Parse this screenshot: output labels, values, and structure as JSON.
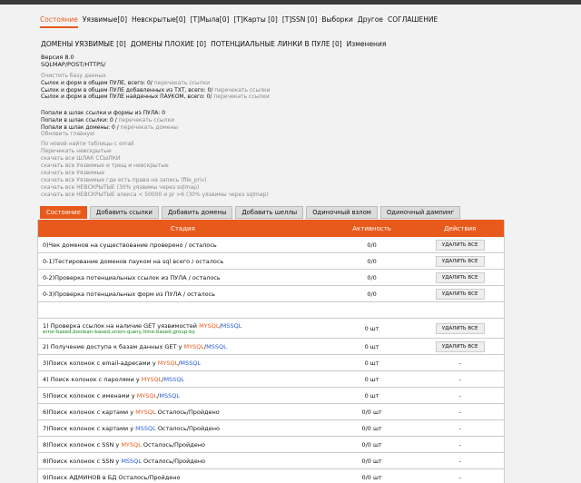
{
  "nav": {
    "items": [
      "Состояние",
      "Уязвимые[0]",
      "Невскрытые[0]",
      "[T]Мыла[0]",
      "[T]Карты [0]",
      "[T]SSN [0]",
      "Выборки",
      "Другое",
      "СОГЛАШЕНИЕ"
    ]
  },
  "subnav": {
    "items": [
      "ДОМЕНЫ УЯЗВИМЫЕ [0]",
      "ДОМЕНЫ ПЛОХИЕ [0]",
      "ПОТЕНЦИАЛЬНЫЕ ЛИНКИ В ПУЛЕ [0]",
      "Изменения"
    ]
  },
  "version": {
    "line1": "Версия 8.0",
    "line2": "SQLMAP/POST/HTTPS/"
  },
  "info": {
    "clear": "Очистить базу данных",
    "l1_text": "Сылок и форм в общем ПУЛЕ, всего: 0/",
    "l1_link": "перечекать ссылки",
    "l2_text": "Сылок и форм в общем ПУЛЕ добавленных из TXT, всего: 0/",
    "l2_link": "перечекать ссылки",
    "l3_text": "Сылок и форм в общем ПУЛЕ найденных ПАУКОМ, всего: 0/",
    "l3_link": "перечекать ссылки"
  },
  "info2": {
    "l1": "Попали в шлак ссылки и формы из ПУЛА: 0",
    "l2_text": "Попали в шлак ссылки: 0 /",
    "l2_link": "перечекать ссылки",
    "l3_text": "Попали в шлак домены: 0 /",
    "l3_link": "перечекать домены",
    "l4": "Обновить главную"
  },
  "info3": {
    "lines": [
      "По новой найти таблицы с email",
      "Перечекать невскрытые",
      "скачать все ШЛАК ССЫЛКИ",
      "скачать все Уязвимые и трещ и невскрытые",
      "скачать все Уязвимые",
      "скачать все Уязвимые где есть права на запись (file_priv)",
      "скачать все НЕВСКРЫТЫЕ (30% уязвимы через sqlmap)",
      "скачать все НЕВСКРЫТЫЕ алекса < 50000 и pr >6 (30% уязвимы через sqlmap)"
    ]
  },
  "tabs": [
    "Состояние",
    "Добавить ссылки",
    "Добавить домены",
    "Добавить шеллы",
    "Одиночный взлом",
    "Одиночный дампинг"
  ],
  "table": {
    "headers": [
      "Стадия",
      "Активность",
      "Действия"
    ],
    "delete_label": "УДАЛИТЬ ВСЕ",
    "dash": "-",
    "rows1": [
      {
        "stage": "0)Чек доменов на существование проверено / осталось",
        "activity": "0/0"
      },
      {
        "stage": "0-1)Тестирование доменов пауком на sql всего / осталось",
        "activity": "0/0"
      },
      {
        "stage": "0-2)Проверка потенциальных ссылок из ПУЛА / осталось",
        "activity": "0/0"
      },
      {
        "stage": "0-3)Проверка потенциальных форм из ПУЛА / осталось",
        "activity": "0/0"
      }
    ],
    "r1": {
      "a": "1) Проверка ссылок на наличие GET уязвимостей ",
      "mysql": "MYSQL",
      "sep": "/",
      "mssql": "MSSQL",
      "sub": "error-based,boolean-based,union-query,time-based,group-by",
      "activity": "0 шт"
    },
    "r2": {
      "a": "2) Получение доступа к базам данных GET у ",
      "mysql": "MYSQL",
      "sep": "/",
      "mssql": "MSSQL",
      "activity": "0 шт"
    },
    "r3": {
      "a": "3)Поиск колонок с email-адресами у ",
      "mysql": "MYSQL",
      "sep": "/",
      "mssql": "MSSQL",
      "activity": "0 шт"
    },
    "r4": {
      "a": "4) Поиск колонок с паролями у ",
      "mysql": "MYSQL",
      "sep": "/",
      "mssql": "MSSQL",
      "activity": "0 шт"
    },
    "r5": {
      "a": "5)Поиск колонок с именами у ",
      "mysql": "MYSQL",
      "sep": "/",
      "mssql": "MSSQL",
      "activity": "0 шт"
    },
    "r6": {
      "a": "6)Поиск колонок с картами у ",
      "mysql": "MYSQL",
      "b": " Осталось/Пройдено",
      "activity": "0/0 шт"
    },
    "r7": {
      "a": "7)Поиск колонок с картами у ",
      "mssql": "MSSQL",
      "b": " Осталось/Пройдено",
      "activity": "0/0 шт"
    },
    "r8": {
      "a": "8)Поиск колонок с SSN у ",
      "mysql": "MYSQL",
      "b": " Осталось/Пройдено",
      "activity": "0/0 шт"
    },
    "r9": {
      "a": "8)Поиск колонок с SSN у ",
      "mssql": "MSSQL",
      "b": " Осталось/Пройдено",
      "activity": "0/0 шт"
    },
    "r10": {
      "a": "9)Поиск АДМИНОВ в БД Осталось/Пройдено",
      "activity": "0/0 шт"
    }
  }
}
